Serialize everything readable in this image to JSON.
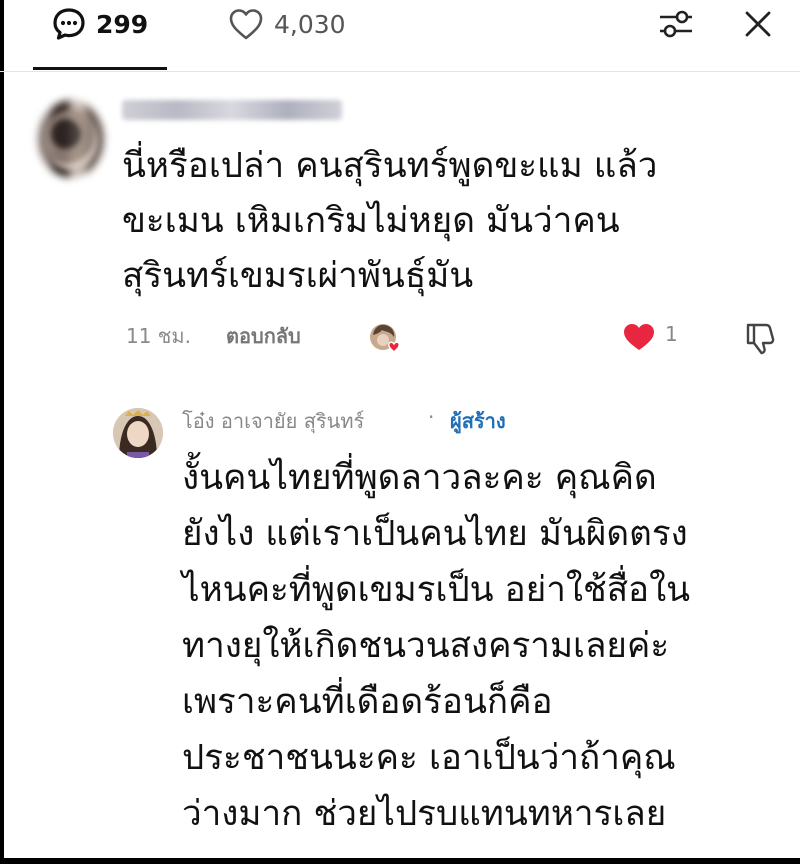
{
  "topbar": {
    "comments_count": "299",
    "likes_count": "4,030",
    "icons": [
      "comment-bubble-icon",
      "heart-outline-icon",
      "filter-sliders-icon",
      "close-icon"
    ]
  },
  "comment": {
    "text": "นี่หรือเปล่า คนสุรินทร์พูดขะแม แล้ว\nขะเมน เหิมเกริมไม่หยุด มันว่าคน\nสุรินทร์เขมรเผ่าพันธุ์มัน",
    "time": "11 ชม.",
    "reply_label": "ตอบกลับ",
    "likes": "1"
  },
  "reply": {
    "author": "โอ๋ง อาเจายัย สุรินทร์",
    "separator": "·",
    "badge": "ผู้สร้าง",
    "text": "งั้นคนไทยที่พูดลาวละคะ คุณคิด\nยังไง แต่เราเป็นคนไทย มันผิดตรง\nไหนคะที่พูดเขมรเป็น อย่าใช้สื่อใน\nทางยุให้เกิดชนวนสงครามเลยค่ะ\nเพราะคนที่เดือดร้อนก็คือ\nประชาชนนะคะ เอาเป็นว่าถ้าคุณ\nว่างมาก ช่วยไปรบแทนทหารเลย"
  },
  "colors": {
    "like_red": "#e8263f",
    "creator_blue": "#1e6fb8",
    "meta_gray": "#8a8a8a"
  }
}
